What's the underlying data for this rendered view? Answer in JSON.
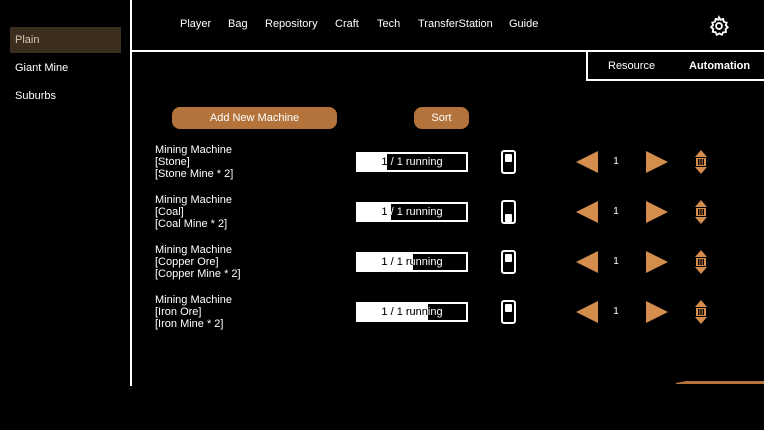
{
  "sidebar": {
    "items": [
      {
        "label": "Plain",
        "active": true
      },
      {
        "label": "Giant Mine",
        "active": false
      },
      {
        "label": "Suburbs",
        "active": false
      }
    ]
  },
  "nav": {
    "items": [
      "Player",
      "Bag",
      "Repository",
      "Craft",
      "Tech",
      "TransferStation",
      "Guide"
    ],
    "settings_icon": "gear-icon"
  },
  "subtabs": {
    "items": [
      {
        "label": "Resource",
        "active": false
      },
      {
        "label": "Automation",
        "active": true
      }
    ]
  },
  "toolbar": {
    "add_label": "Add New Machine",
    "sort_label": "Sort"
  },
  "colors": {
    "accent": "#b3733a",
    "arrow": "#d48d4d",
    "sidebar_active_bg": "#3b2e1f"
  },
  "machines": [
    {
      "name": "Mining Machine",
      "resource": "[Stone]",
      "location": "[Stone Mine * 2]",
      "status": "1 / 1 running",
      "progress": 0.27,
      "count": "1"
    },
    {
      "name": "Mining Machine",
      "resource": "[Coal]",
      "location": "[Coal Mine * 2]",
      "status": "1 / 1 running",
      "progress": 0.31,
      "count": "1"
    },
    {
      "name": "Mining Machine",
      "resource": "[Copper Ore]",
      "location": "[Copper Mine * 2]",
      "status": "1 / 1 running",
      "progress": 0.51,
      "count": "1"
    },
    {
      "name": "Mining Machine",
      "resource": "[Iron Ore]",
      "location": "[Iron Mine * 2]",
      "status": "1 / 1 running",
      "progress": 0.65,
      "count": "1"
    }
  ]
}
